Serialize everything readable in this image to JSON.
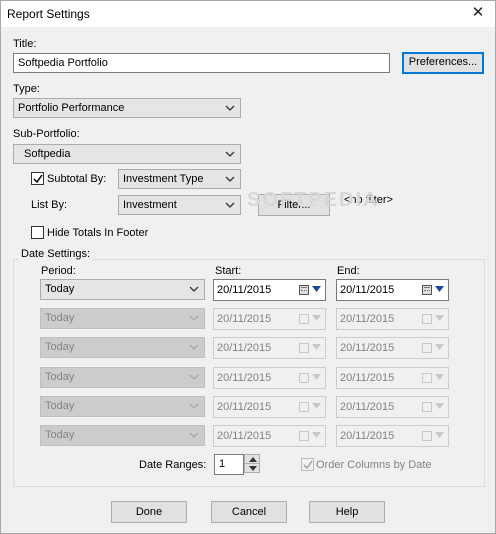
{
  "window": {
    "title": "Report Settings",
    "close_glyph": "✕"
  },
  "title_field": {
    "label": "Title:",
    "value": "Softpedia Portfolio"
  },
  "preferences_button": "Preferences...",
  "type_field": {
    "label": "Type:",
    "value": "Portfolio Performance"
  },
  "subportfolio_field": {
    "label": "Sub-Portfolio:",
    "value": "Softpedia"
  },
  "subtotal": {
    "label": "Subtotal By:",
    "checked": true,
    "value": "Investment Type"
  },
  "listby": {
    "label": "List By:",
    "value": "Investment",
    "filter_button": "Filter...",
    "filter_status": "<no filter>"
  },
  "hide_totals": {
    "label": "Hide Totals In Footer",
    "checked": false
  },
  "date_settings": {
    "group_label": "Date Settings:",
    "period_header": "Period:",
    "start_header": "Start:",
    "end_header": "End:",
    "rows": [
      {
        "period": "Today",
        "start": "20/11/2015",
        "end": "20/11/2015",
        "enabled": true
      },
      {
        "period": "Today",
        "start": "20/11/2015",
        "end": "20/11/2015",
        "enabled": false
      },
      {
        "period": "Today",
        "start": "20/11/2015",
        "end": "20/11/2015",
        "enabled": false
      },
      {
        "period": "Today",
        "start": "20/11/2015",
        "end": "20/11/2015",
        "enabled": false
      },
      {
        "period": "Today",
        "start": "20/11/2015",
        "end": "20/11/2015",
        "enabled": false
      },
      {
        "period": "Today",
        "start": "20/11/2015",
        "end": "20/11/2015",
        "enabled": false
      }
    ],
    "date_ranges_label": "Date Ranges:",
    "date_ranges_value": "1",
    "order_columns": {
      "label": "Order Columns by Date",
      "checked": true,
      "enabled": false
    }
  },
  "buttons": {
    "done": "Done",
    "cancel": "Cancel",
    "help": "Help"
  },
  "watermark": "SOFTPEDIA",
  "colors": {
    "focus": "#0078d7",
    "window_bg": "#f0f0f0",
    "disabled_text": "#838383"
  }
}
